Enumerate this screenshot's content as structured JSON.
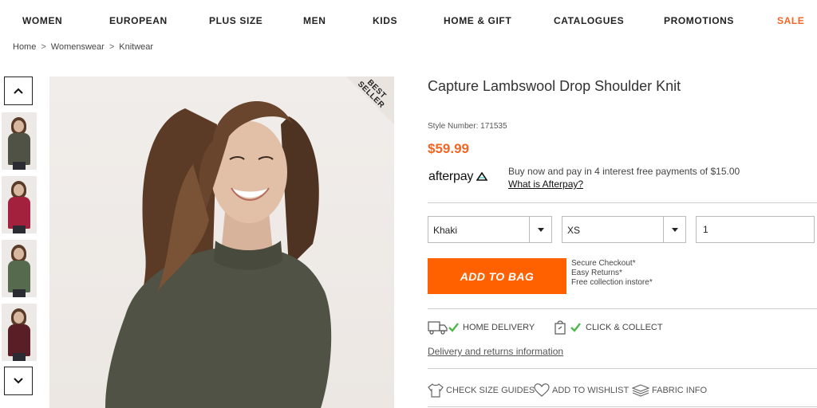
{
  "nav": {
    "items": [
      "WOMEN",
      "EUROPEAN",
      "PLUS SIZE",
      "MEN",
      "KIDS",
      "HOME & GIFT",
      "CATALOGUES",
      "PROMOTIONS",
      "SALE"
    ]
  },
  "breadcrumb": [
    "Home",
    "Womenswear",
    "Knitwear"
  ],
  "breadcrumb_separator": ">",
  "image": {
    "ribbon": "BEST SELLER",
    "thumbnail_colors": [
      "#4f5244",
      "#a3213c",
      "#566b4d",
      "#5a1e26"
    ]
  },
  "product": {
    "title": "Capture Lambswool Drop Shoulder Knit",
    "style_number": "Style Number: 171535",
    "price": "$59.99",
    "price_color": "#f26522"
  },
  "afterpay": {
    "logo": "afterpay",
    "text": "Buy now and pay in 4 interest free payments of $15.00",
    "link": "What is Afterpay?"
  },
  "options": {
    "colour": "Khaki",
    "size": "XS",
    "quantity": "1"
  },
  "cart": {
    "add_label": "ADD TO BAG",
    "button_color": "#ff6100",
    "perks": [
      "Secure Checkout*",
      "Easy Returns*",
      "Free collection instore*"
    ]
  },
  "delivery": {
    "home": "HOME DELIVERY",
    "click": "CLICK & COLLECT",
    "link": "Delivery and returns information"
  },
  "tools": {
    "size_guides": "CHECK SIZE GUIDES",
    "wishlist": "ADD TO WISHLIST",
    "fabric": "FABRIC INFO"
  }
}
